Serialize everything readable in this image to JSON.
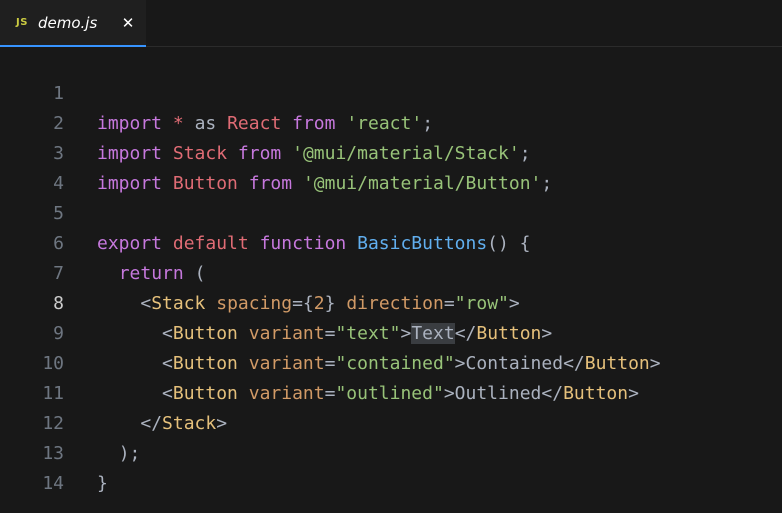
{
  "tab": {
    "icon_text": "JS",
    "label": "demo.js",
    "close": "✕"
  },
  "editor": {
    "active_line": 8,
    "lines": [
      {
        "n": "1"
      },
      {
        "n": "2"
      },
      {
        "n": "3"
      },
      {
        "n": "4"
      },
      {
        "n": "5"
      },
      {
        "n": "6"
      },
      {
        "n": "7"
      },
      {
        "n": "8"
      },
      {
        "n": "9"
      },
      {
        "n": "10"
      },
      {
        "n": "11"
      },
      {
        "n": "12"
      },
      {
        "n": "13"
      },
      {
        "n": "14"
      }
    ],
    "tokens": {
      "l1": [
        "import",
        "*",
        "as",
        "React",
        "from",
        "'react'",
        ";"
      ],
      "l2": [
        "import",
        "Stack",
        "from",
        "'@mui/material/Stack'",
        ";"
      ],
      "l3": [
        "import",
        "Button",
        "from",
        "'@mui/material/Button'",
        ";"
      ],
      "l5": [
        "export",
        "default",
        "function",
        "BasicButtons",
        "() {"
      ],
      "l6": [
        "return",
        "("
      ],
      "l7": [
        "<",
        "Stack",
        "spacing",
        "={",
        "2",
        "}",
        "direction",
        "=",
        "\"row\"",
        ">"
      ],
      "l8": [
        "<",
        "Button",
        "variant",
        "=",
        "\"text\"",
        ">",
        "Text",
        "</",
        "Button",
        ">"
      ],
      "l9": [
        "<",
        "Button",
        "variant",
        "=",
        "\"contained\"",
        ">",
        "Contained",
        "</",
        "Button",
        ">"
      ],
      "l10": [
        "<",
        "Button",
        "variant",
        "=",
        "\"outlined\"",
        ">",
        "Outlined",
        "</",
        "Button",
        ">"
      ],
      "l11": [
        "</",
        "Stack",
        ">"
      ],
      "l12": [
        ");"
      ],
      "l13": [
        "}"
      ]
    }
  },
  "colors": {
    "keyword": "#c678dd",
    "identifier_red": "#e06c75",
    "string": "#98c379",
    "function": "#61afef",
    "tag": "#e5c07b",
    "attribute": "#d19a66",
    "tab_accent": "#3794ff"
  }
}
